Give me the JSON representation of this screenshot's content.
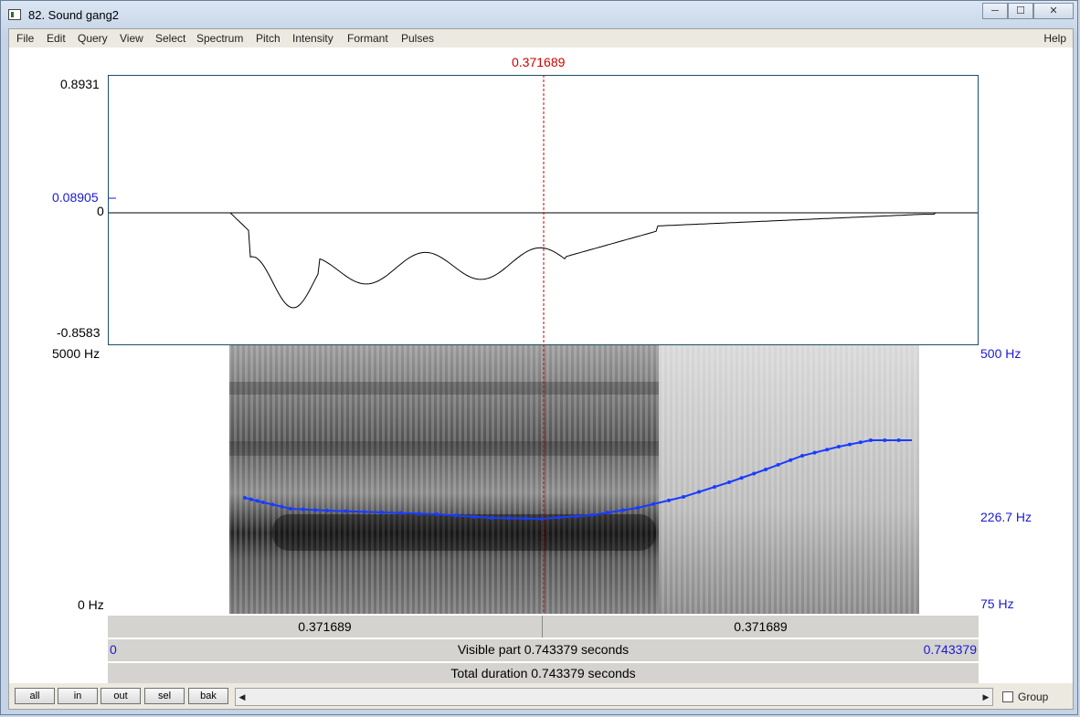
{
  "window": {
    "title": "82. Sound gang2",
    "controls": [
      "─",
      "☐",
      "✕"
    ]
  },
  "menu": {
    "items": [
      "File",
      "Edit",
      "Query",
      "View",
      "Select",
      "Spectrum",
      "Pitch",
      "Intensity",
      "Formant",
      "Pulses"
    ],
    "help": "Help"
  },
  "cursor": {
    "time_label": "0.371689"
  },
  "waveform": {
    "max_label": "0.8931",
    "cursor_value_label": "0.08905",
    "zero_label": "0",
    "min_label": "-0.8583"
  },
  "spectrogram": {
    "freq_max_label": "5000 Hz",
    "freq_min_label": "0 Hz",
    "pitch_max_label": "500 Hz",
    "pitch_cursor_label": "226.7 Hz",
    "pitch_min_label": "75 Hz"
  },
  "time_bars": {
    "left_segment": "0.371689",
    "right_segment": "0.371689",
    "start": "0",
    "visible_part": "Visible part 0.743379 seconds",
    "end": "0.743379",
    "total_duration": "Total duration 0.743379 seconds"
  },
  "toolbar": {
    "all": "all",
    "in": "in",
    "out": "out",
    "sel": "sel",
    "bak": "bak",
    "group_label": "Group",
    "group_checked": false
  },
  "colors": {
    "cursor": "#d00000",
    "pitch": "#1a3cff",
    "axis_blue": "#1a1ad6"
  }
}
